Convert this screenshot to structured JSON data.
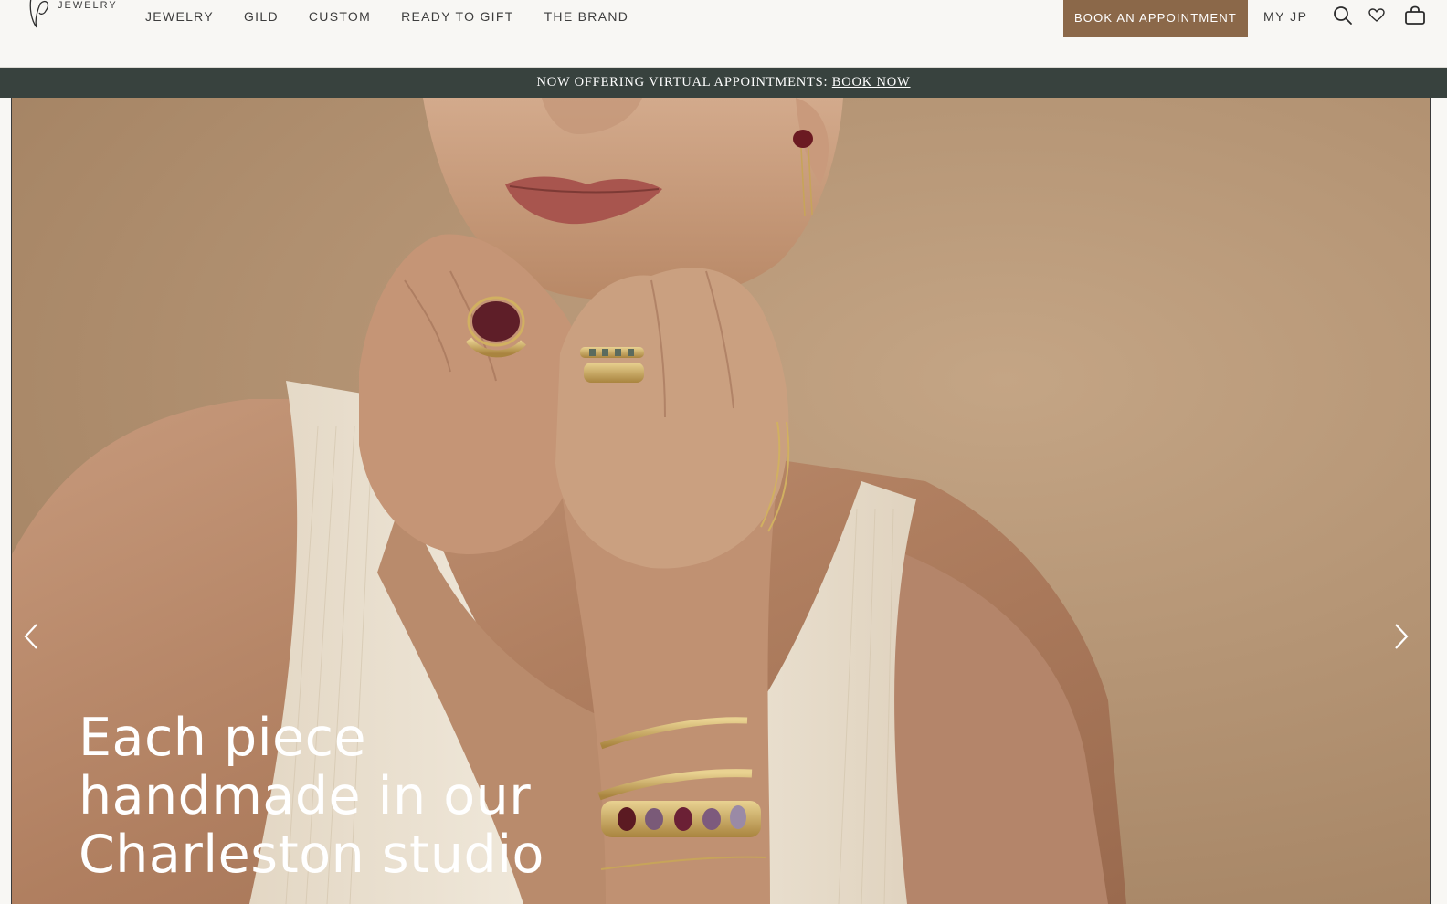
{
  "brand": {
    "logo_text": "JEWELRY",
    "accent": "#8b6849",
    "bar_color": "#38423e"
  },
  "nav": {
    "items": [
      {
        "label": "JEWELRY"
      },
      {
        "label": "GILD"
      },
      {
        "label": "CUSTOM"
      },
      {
        "label": "READY TO GIFT"
      },
      {
        "label": "THE BRAND"
      }
    ]
  },
  "header": {
    "book_label": "BOOK AN APPOINTMENT",
    "account_label": "MY JP",
    "icons": [
      "search-icon",
      "heart-icon",
      "bag-icon"
    ]
  },
  "announcement": {
    "text": "NOW OFFERING VIRTUAL APPOINTMENTS: ",
    "link_label": "BOOK NOW"
  },
  "hero": {
    "heading_line1": "Each piece",
    "heading_line2": "handmade in our",
    "heading_line3": "Charleston studio",
    "prev_icon": "chevron-left-icon",
    "next_icon": "chevron-right-icon"
  }
}
